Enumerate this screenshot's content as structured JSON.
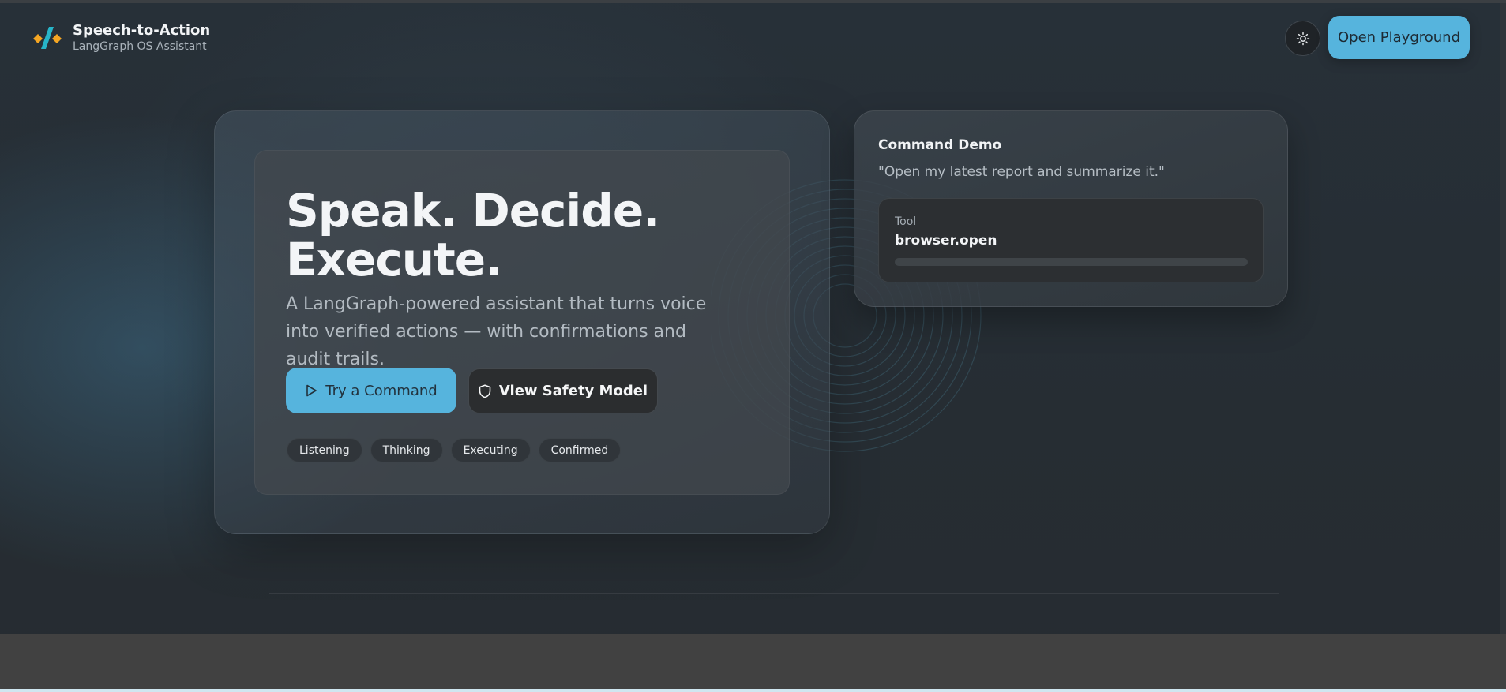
{
  "header": {
    "brand_title": "Speech-to-Action",
    "brand_subtitle": "LangGraph OS Assistant",
    "theme_toggle_icon": "sun-icon",
    "playground_label": "Open Playground"
  },
  "hero": {
    "title_line1": "Speak. Decide.",
    "title_line2": "Execute.",
    "description": "A LangGraph-powered assistant that turns voice into verified actions — with confirmations and audit trails.",
    "try_label": "Try a Command",
    "safety_label": "View Safety Model",
    "chips": [
      "Listening",
      "Thinking",
      "Executing",
      "Confirmed"
    ]
  },
  "demo": {
    "title": "Command Demo",
    "quote": "\"Open my latest report and summarize it.\"",
    "tool_label": "Tool",
    "tool_value": "browser.open"
  },
  "colors": {
    "accent": "#56b4dd",
    "background": "#262c31",
    "logo_orange": "#f5a623",
    "logo_teal": "#27b5c9"
  }
}
